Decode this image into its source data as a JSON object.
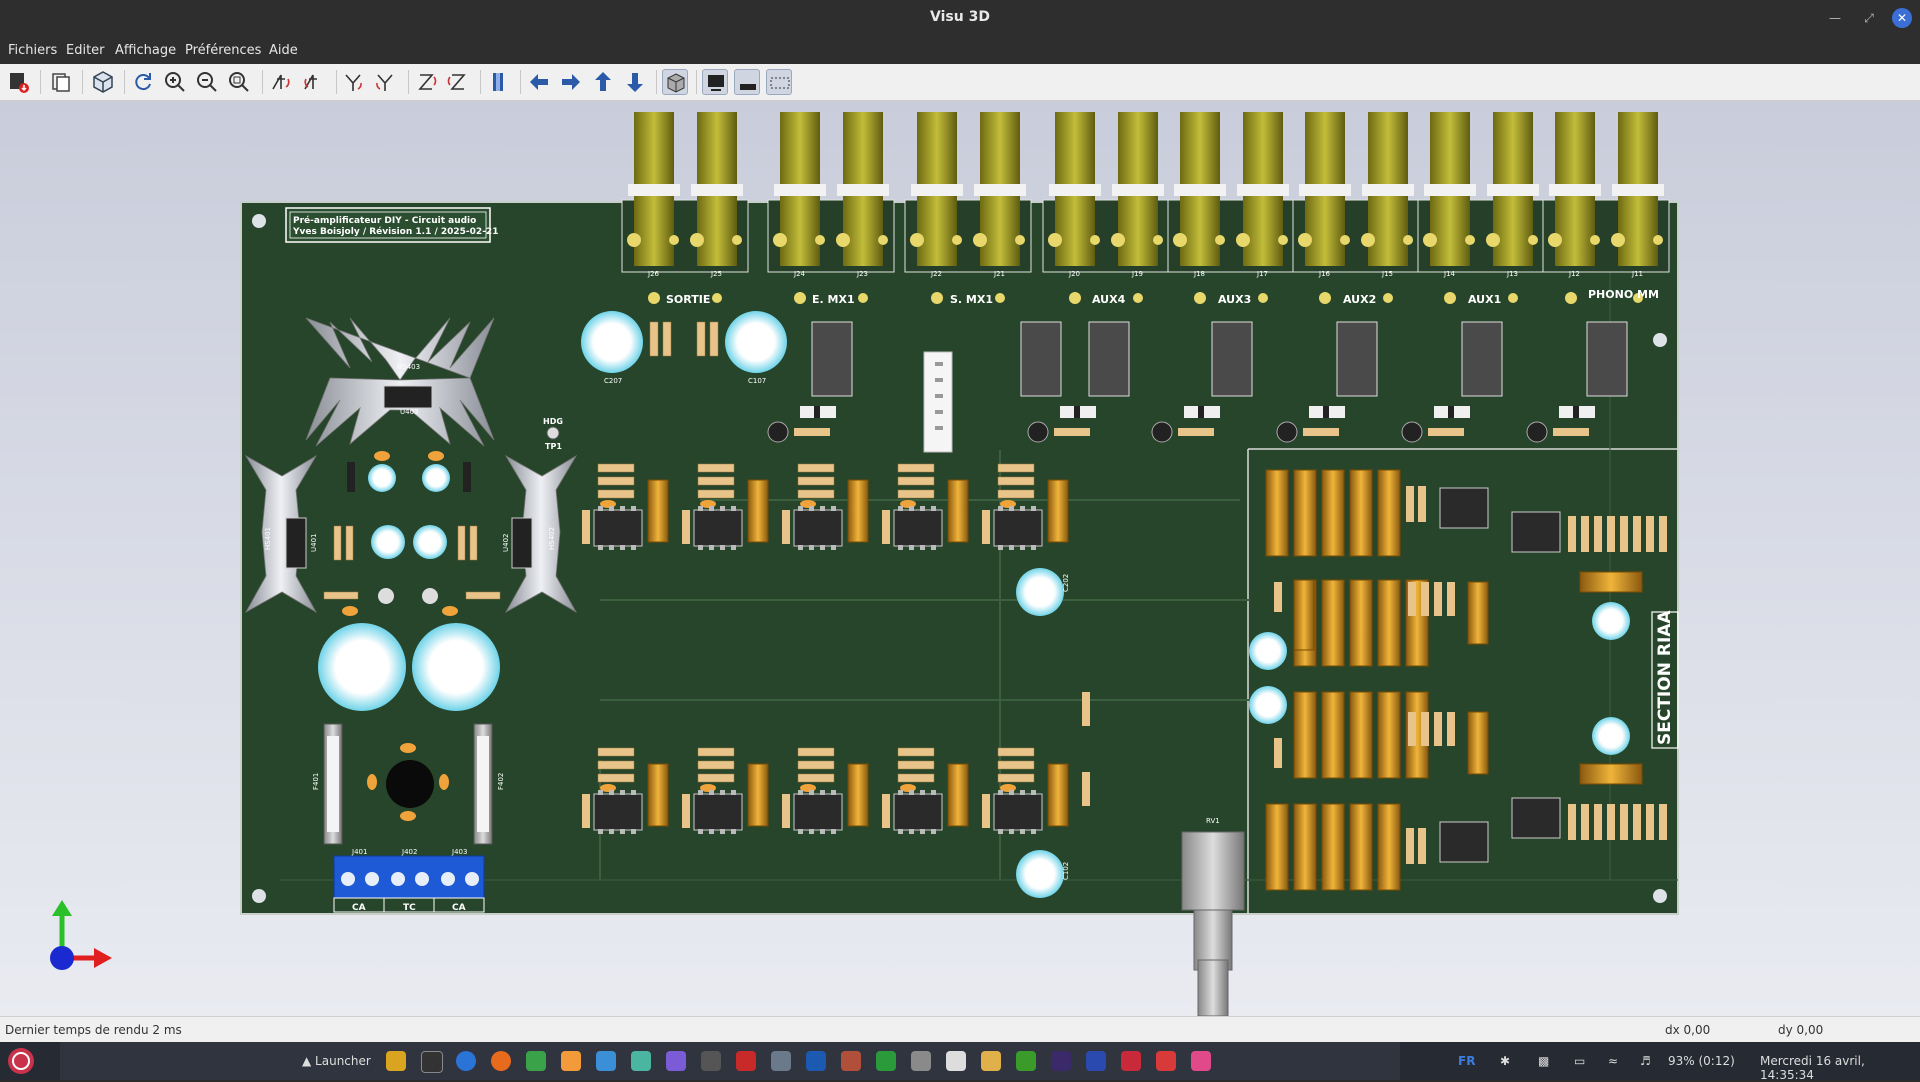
{
  "window": {
    "title": "Visu 3D"
  },
  "menu": [
    "Fichiers",
    "Editer",
    "Affichage",
    "Préférences",
    "Aide"
  ],
  "toolbar": {
    "icons": [
      "export-icon",
      "copy-icon",
      "cube-icon",
      "refresh-icon",
      "zoom-in-icon",
      "zoom-out-icon",
      "zoom-fit-icon",
      "rotate-x-cw-icon",
      "rotate-x-ccw-icon",
      "rotate-y-cw-icon",
      "rotate-y-ccw-icon",
      "rotate-z-cw-icon",
      "rotate-z-ccw-icon",
      "flip-board-icon",
      "arrow-left-icon",
      "arrow-right-icon",
      "arrow-up-icon",
      "arrow-down-icon",
      "orthographic-icon",
      "render-raytrace-icon",
      "render-realtime-icon",
      "render-bbox-icon"
    ]
  },
  "pcb": {
    "title_line1": "Pré-amplificateur DIY - Circuit audio",
    "title_line2": "Yves Boisjoly / Révision 1.1 / 2025-02-21",
    "jack_labels": [
      "SORTIE",
      "E. MX1",
      "S. MX1",
      "AUX4",
      "AUX3",
      "AUX2",
      "AUX1",
      "PHONO MM"
    ],
    "section_label": "SECTION RIAA",
    "terminal_labels": [
      "CA",
      "TC",
      "CA"
    ],
    "terminal_refs": [
      "J401",
      "J402",
      "J403"
    ],
    "top_refs": [
      "J26",
      "J25",
      "J24",
      "J23",
      "J22",
      "J21",
      "J20",
      "J19",
      "J18",
      "J17",
      "J16",
      "J15",
      "J14",
      "J13",
      "J12",
      "J11"
    ],
    "misc_refs": {
      "hs403": "HS403",
      "u403": "U403",
      "hs401": "HS401",
      "hs402": "HS402",
      "u401": "U401",
      "u402": "U402",
      "tp1": "TP1",
      "hdg": "HDG",
      "rv1": "RV1",
      "f401": "F401",
      "f402": "F402",
      "c207": "C207",
      "c107": "C107",
      "c202": "C202",
      "c102": "C102"
    }
  },
  "status": {
    "message": "Dernier temps de rendu 2 ms",
    "dx": "dx 0,00",
    "dy": "dy 0,00"
  },
  "taskbar": {
    "launcher": "Launcher",
    "lang": "FR",
    "battery": "93% (0:12)",
    "datetime": "Mercredi 16 avril, 14:35:34"
  },
  "colors": {
    "board": "#27452b",
    "accent": "#3b6fd6"
  }
}
